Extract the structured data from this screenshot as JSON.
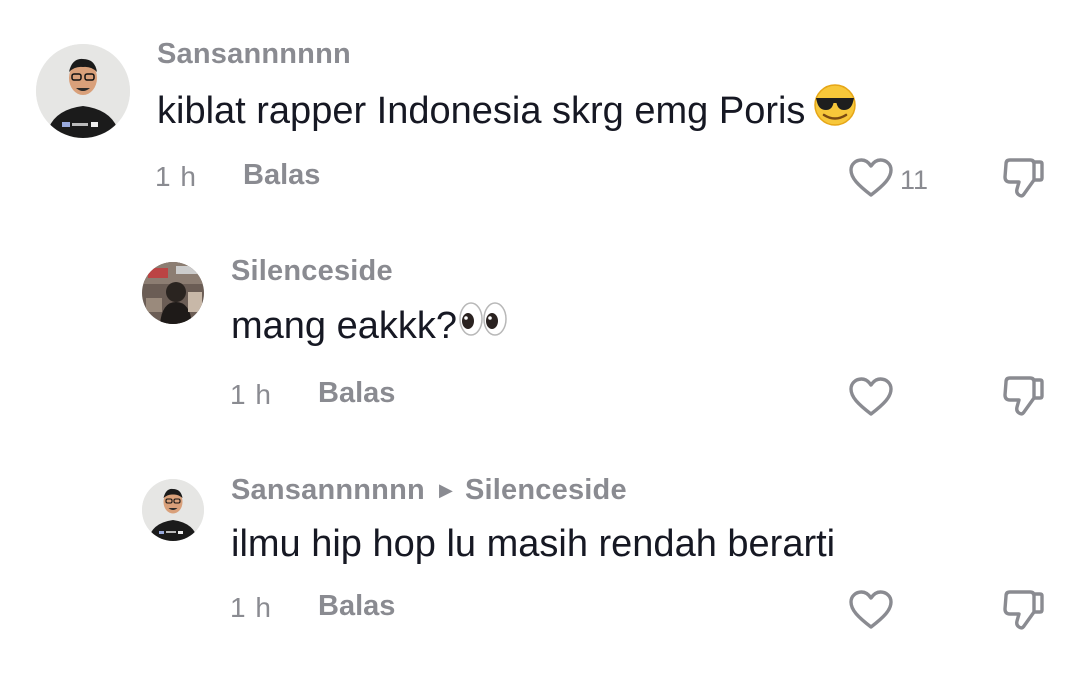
{
  "comments": [
    {
      "username": "Sansannnnnn",
      "text": "kiblat rapper Indonesia skrg emg Poris",
      "emoji": "smiling-face-with-sunglasses",
      "time": "1 h",
      "reply_label": "Balas",
      "likes": "11"
    },
    {
      "username": "Silenceside",
      "text": "mang eakkk?",
      "emoji": "eyes",
      "time": "1 h",
      "reply_label": "Balas",
      "likes": ""
    },
    {
      "username": "Sansannnnnn",
      "reply_to": "Silenceside",
      "text": "ilmu hip hop lu masih rendah berarti",
      "time": "1 h",
      "reply_label": "Balas",
      "likes": ""
    }
  ],
  "colors": {
    "meta_gray": "#8a8b91",
    "text": "#161823",
    "background": "#ffffff"
  }
}
